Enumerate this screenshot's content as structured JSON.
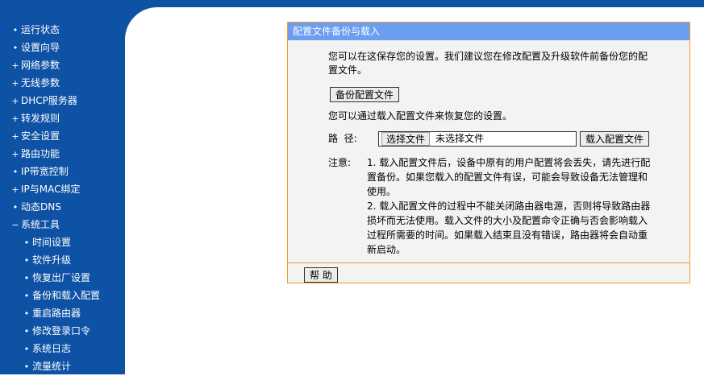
{
  "sidebar": {
    "items": [
      {
        "label": "运行状态",
        "marker": "•"
      },
      {
        "label": "设置向导",
        "marker": "•"
      },
      {
        "label": "网络参数",
        "marker": "+"
      },
      {
        "label": "无线参数",
        "marker": "+"
      },
      {
        "label": "DHCP服务器",
        "marker": "+"
      },
      {
        "label": "转发规则",
        "marker": "+"
      },
      {
        "label": "安全设置",
        "marker": "+"
      },
      {
        "label": "路由功能",
        "marker": "+"
      },
      {
        "label": "IP带宽控制",
        "marker": "•"
      },
      {
        "label": "IP与MAC绑定",
        "marker": "+"
      },
      {
        "label": "动态DNS",
        "marker": "•"
      },
      {
        "label": "系统工具",
        "marker": "−"
      }
    ],
    "subitems": [
      {
        "label": "时间设置",
        "marker": "•"
      },
      {
        "label": "软件升级",
        "marker": "•"
      },
      {
        "label": "恢复出厂设置",
        "marker": "•"
      },
      {
        "label": "备份和载入配置",
        "marker": "•"
      },
      {
        "label": "重启路由器",
        "marker": "•"
      },
      {
        "label": "修改登录口令",
        "marker": "•"
      },
      {
        "label": "系统日志",
        "marker": "•"
      },
      {
        "label": "流量统计",
        "marker": "•"
      }
    ]
  },
  "panel": {
    "title": "配置文件备份与载入",
    "intro": "您可以在这保存您的设置。我们建议您在修改配置及升级软件前备份您的配置文件。",
    "backup_button": "备份配置文件",
    "restore_text": "您可以通过载入配置文件来恢复您的设置。",
    "path_label": "路  径:",
    "file_button": "选择文件",
    "file_status": "未选择文件",
    "load_button": "载入配置文件",
    "note_label": "注意:",
    "note1": "1. 载入配置文件后，设备中原有的用户配置将会丢失，请先进行配置备份。如果您载入的配置文件有误，可能会导致设备无法管理和使用。",
    "note2": "2. 载入配置文件的过程中不能关闭路由器电源，否则将导致路由器损坏而无法使用。载入文件的大小及配置命令正确与否会影响载入过程所需要的时间。如果载入结束且没有错误，路由器将会自动重新启动。",
    "help_button": "帮 助"
  },
  "colors": {
    "sidebar_bg": "#0e52a5",
    "title_bar": "#6b9df1",
    "panel_border": "#f59a2a",
    "panel_bg": "#f3f3f3"
  }
}
